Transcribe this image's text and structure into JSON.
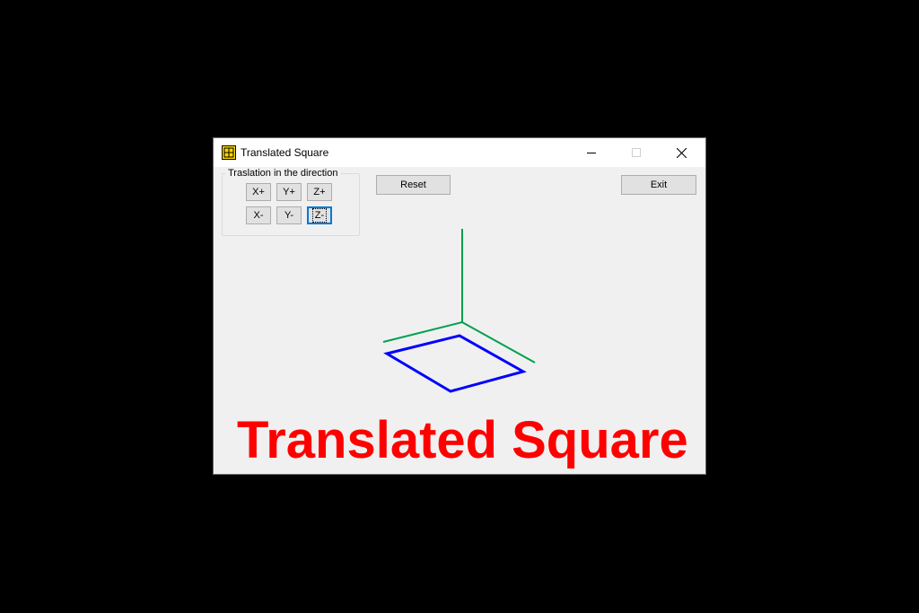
{
  "window": {
    "title": "Translated Square",
    "controls": {
      "minimize_icon": "minimize-icon",
      "maximize_icon": "maximize-icon",
      "close_icon": "close-icon"
    }
  },
  "translation_group": {
    "caption": "Traslation in the direction",
    "buttons_row1": [
      "X+",
      "Y+",
      "Z+"
    ],
    "buttons_row2": [
      "X-",
      "Y-",
      "Z-"
    ]
  },
  "actions": {
    "reset_label": "Reset",
    "exit_label": "Exit"
  },
  "canvas": {
    "heading_part1": "Translated",
    "heading_part2": "Square",
    "colors": {
      "axes": "#00a050",
      "square": "#0000ff",
      "heading": "#ff0000"
    }
  }
}
